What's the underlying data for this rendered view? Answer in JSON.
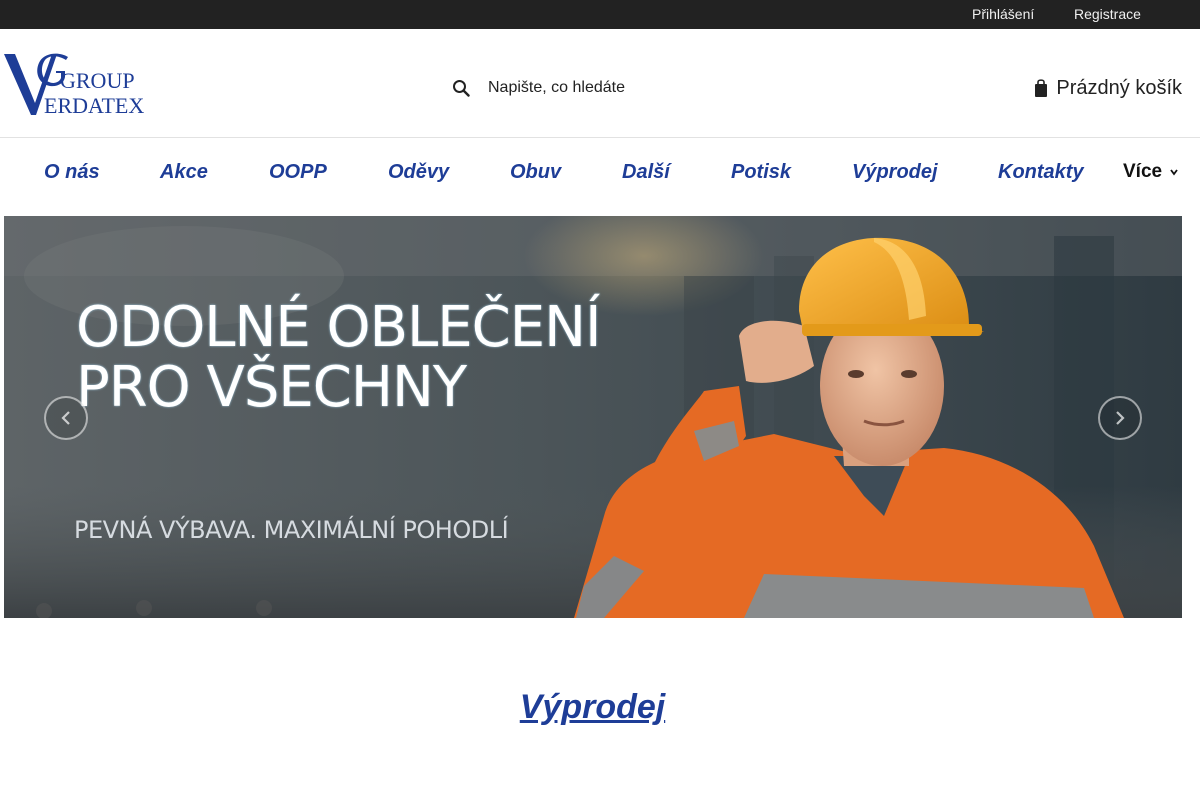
{
  "topbar": {
    "login_label": "Přihlášení",
    "register_label": "Registrace"
  },
  "header": {
    "logo_text_group": "GROUP",
    "logo_text_verdatex": "ERDATEX",
    "search_placeholder": "Napište, co hledáte",
    "cart_label": "Prázdný košík"
  },
  "nav": {
    "items": [
      {
        "label": "O nás"
      },
      {
        "label": "Akce"
      },
      {
        "label": "OOPP"
      },
      {
        "label": "Oděvy"
      },
      {
        "label": "Obuv"
      },
      {
        "label": "Další"
      },
      {
        "label": "Potisk"
      },
      {
        "label": "Výprodej"
      },
      {
        "label": "Kontakty"
      }
    ],
    "more_label": "Více"
  },
  "hero": {
    "headline_line1": "ODOLNÉ OBLEČENÍ",
    "headline_line2": "PRO VŠECHNY",
    "tagline": "PEVNÁ VÝBAVA. MAXIMÁLNÍ POHODLÍ"
  },
  "section": {
    "title": "Výprodej"
  },
  "colors": {
    "brand_blue": "#1e3d97",
    "topbar_bg": "#222222",
    "hivis_orange": "#e56a24",
    "helmet_yellow": "#f1a322"
  }
}
